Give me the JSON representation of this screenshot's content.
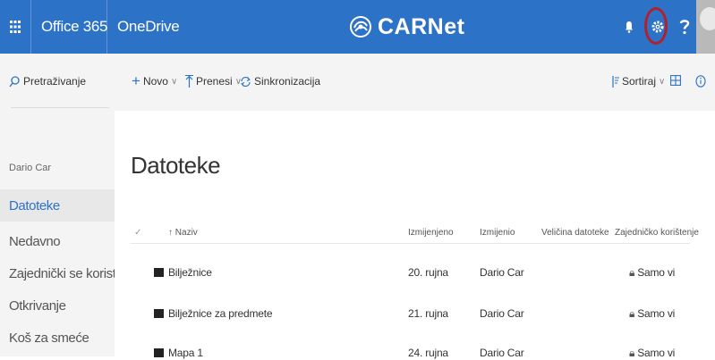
{
  "topbar": {
    "app_launcher": "Office 365",
    "app_name": "OneDrive",
    "brand": "CARNet",
    "accent": "#2c72c7",
    "highlight_ring": "#b3202d"
  },
  "commands": {
    "search": "Pretraživanje",
    "new": "Novo",
    "upload": "Prenesi",
    "sync": "Sinkronizacija",
    "sort": "Sortiraj"
  },
  "nav": {
    "user": "Dario Car",
    "items": [
      "Datoteke",
      "Nedavno",
      "Zajednički se koristi sa mn",
      "Otkrivanje",
      "Koš za smeće"
    ]
  },
  "main": {
    "title": "Datoteke",
    "columns": {
      "name": "Naziv",
      "modified": "Izmijenjeno",
      "modified_by": "Izmijenio",
      "size": "Veličina datoteke",
      "sharing": "Zajedničko korištenje"
    },
    "rows": [
      {
        "name": "Bilježnice",
        "modified": "20. rujna",
        "modified_by": "Dario Car",
        "sharing": "Samo vi"
      },
      {
        "name": "Bilježnice za predmete",
        "modified": "21. rujna",
        "modified_by": "Dario Car",
        "sharing": "Samo vi"
      },
      {
        "name": "Mapa 1",
        "modified": "24. rujna",
        "modified_by": "Dario Car",
        "sharing": "Samo vi"
      }
    ]
  }
}
